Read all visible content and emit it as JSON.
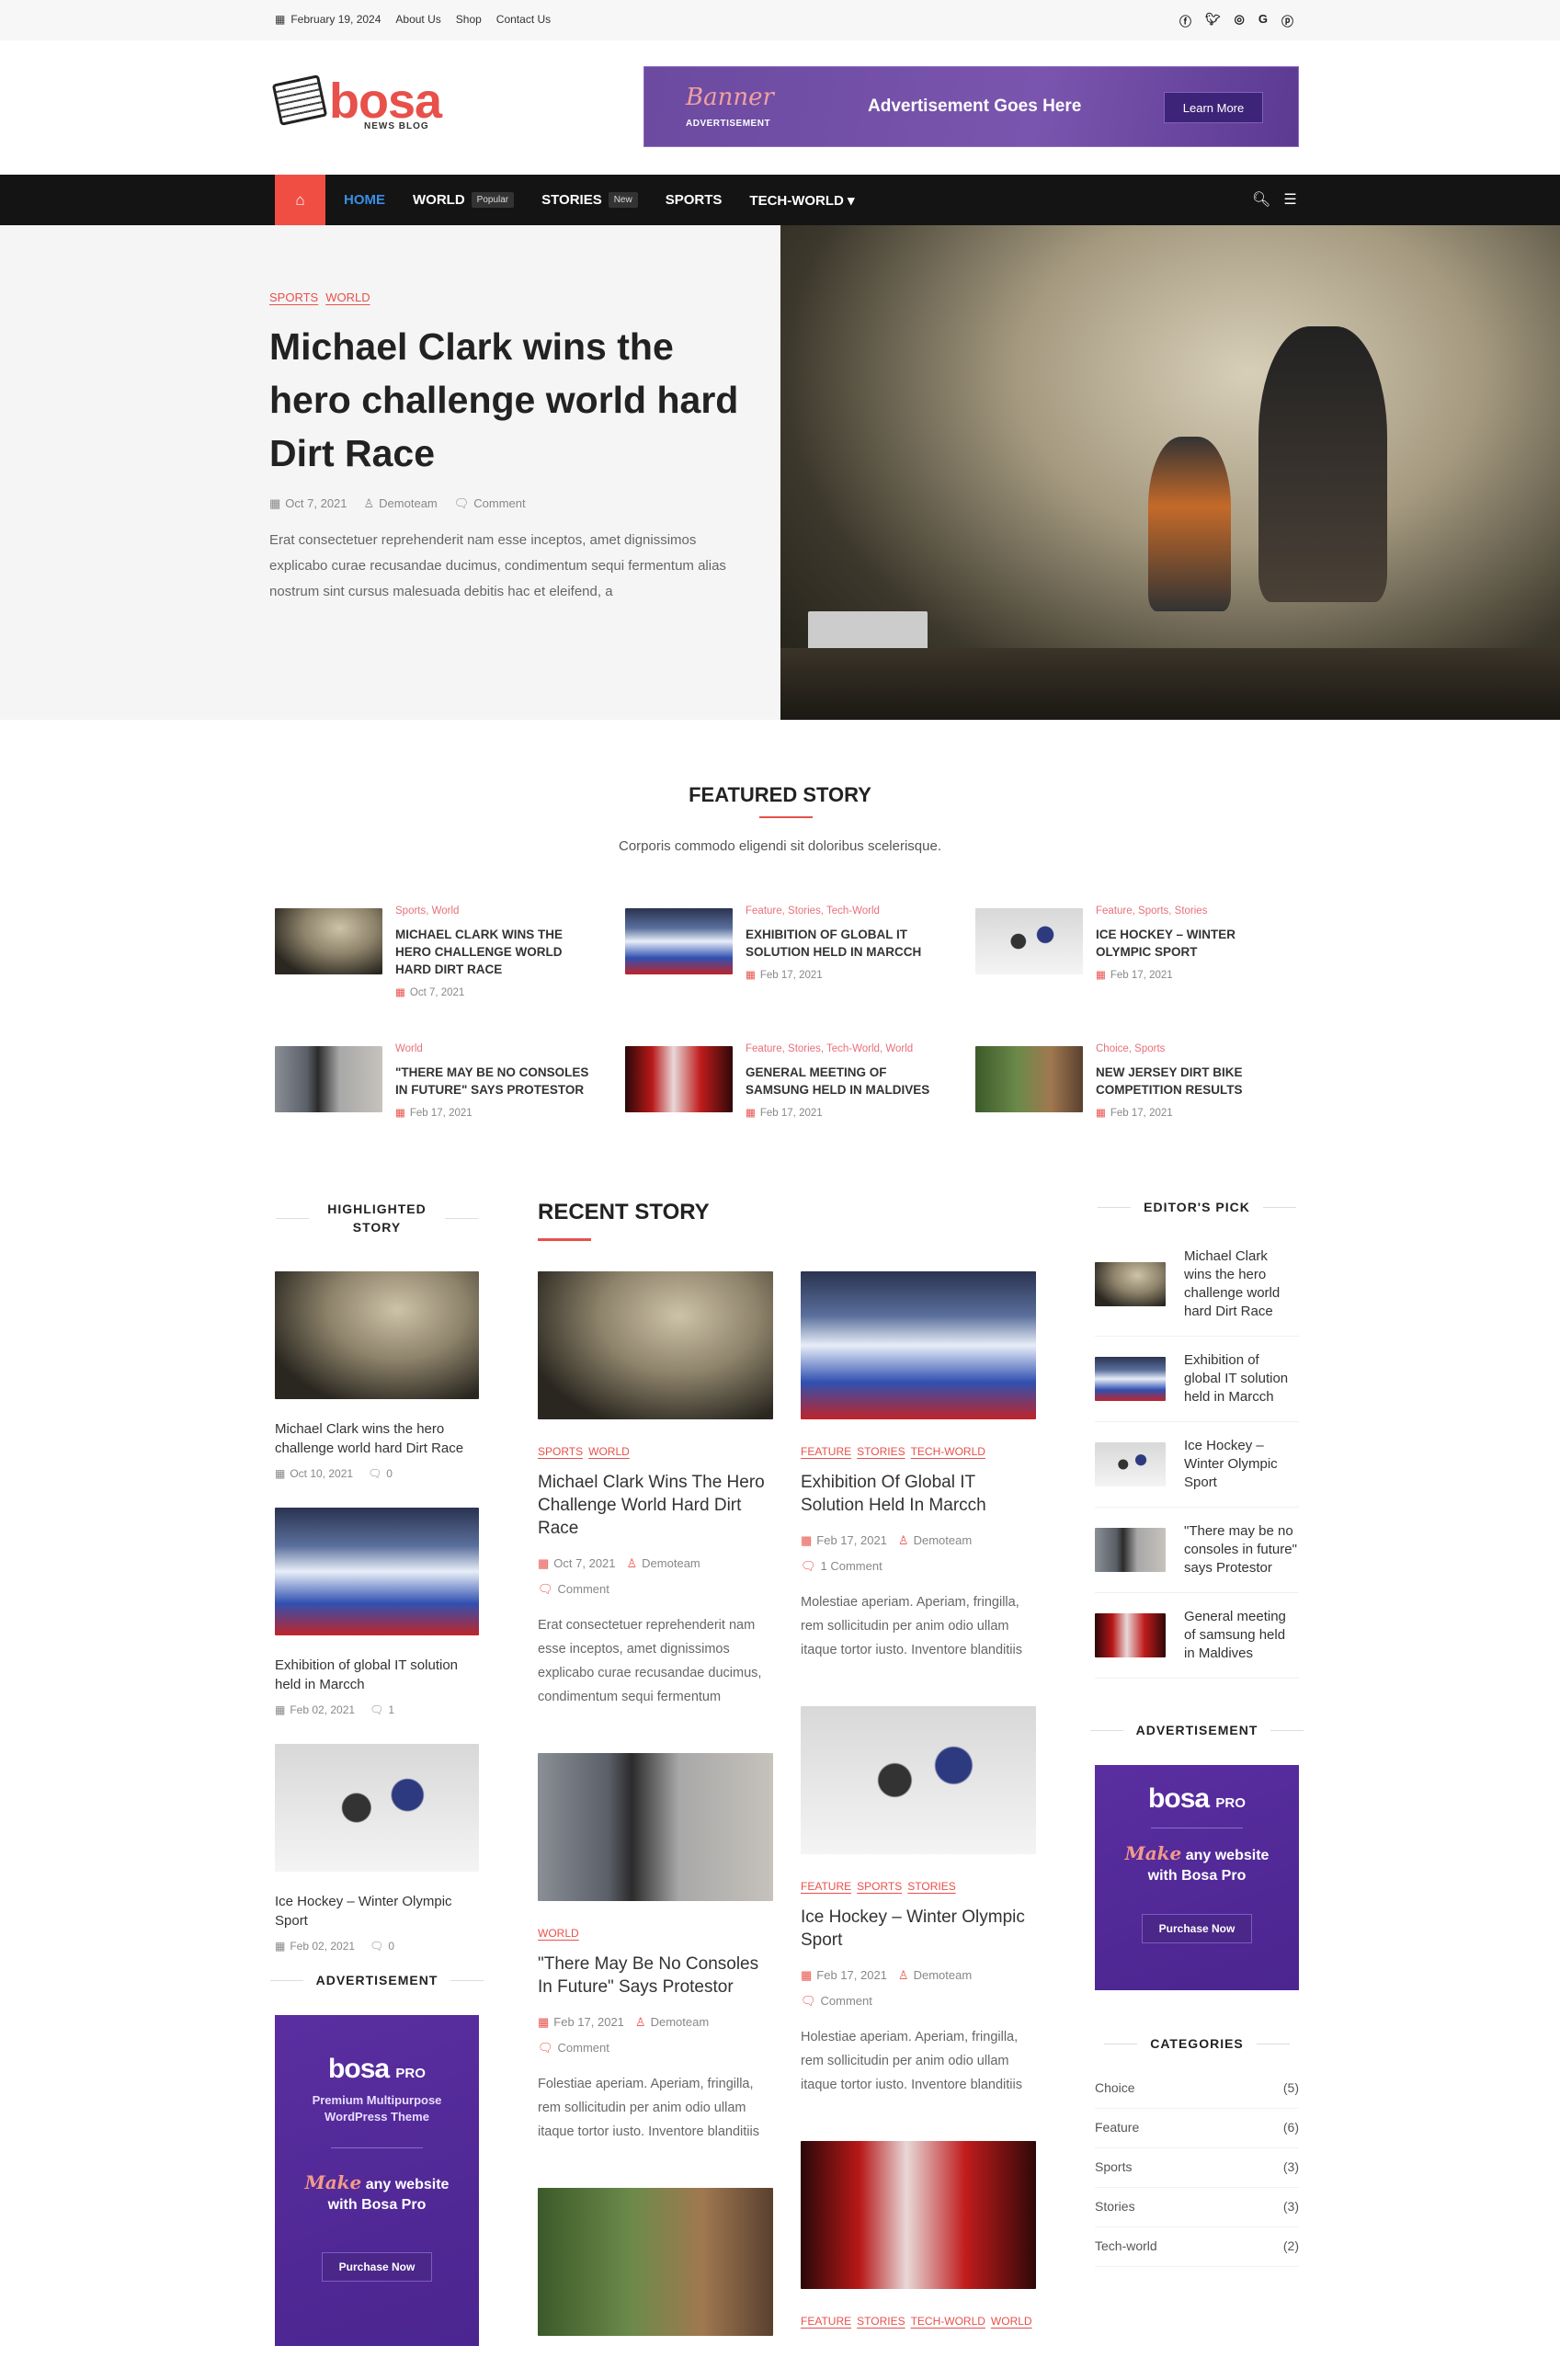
{
  "topbar": {
    "date": "February 19, 2024",
    "links": [
      "About Us",
      "Shop",
      "Contact Us"
    ],
    "social": [
      "facebook-icon",
      "twitter-icon",
      "instagram-icon",
      "google-icon",
      "pinterest-icon"
    ]
  },
  "logo": {
    "word": "bosa",
    "sub": "NEWS BLOG"
  },
  "banner": {
    "script": "Banner",
    "label": "ADVERTISEMENT",
    "text": "Advertisement Goes Here",
    "button": "Learn More"
  },
  "nav": {
    "items": [
      {
        "label": "HOME",
        "active": true
      },
      {
        "label": "WORLD",
        "badge": "Popular"
      },
      {
        "label": "STORIES",
        "badge": "New"
      },
      {
        "label": "SPORTS"
      },
      {
        "label": "TECH-WORLD ▾"
      }
    ]
  },
  "hero": {
    "cats": [
      "SPORTS",
      "WORLD"
    ],
    "title": "Michael Clark wins the hero challenge world hard Dirt Race",
    "date": "Oct 7, 2021",
    "author": "Demoteam",
    "comment": "Comment",
    "excerpt": "Erat consectetuer reprehenderit nam esse inceptos, amet dignissimos explicabo curae recusandae ducimus, condimentum sequi fermentum alias nostrum sint cursus malesuada debitis hac et eleifend, a"
  },
  "featured": {
    "title": "FEATURED STORY",
    "subtitle": "Corporis commodo eligendi sit doloribus scelerisque.",
    "items": [
      {
        "cats": "Sports, World",
        "title": "Michael Clark wins the hero challenge world hard Dirt Race",
        "date": "Oct 7, 2021",
        "img": "dirt"
      },
      {
        "cats": "Feature, Stories, Tech-World",
        "title": "Exhibition of global IT solution held in Marcch",
        "date": "Feb 17, 2021",
        "img": "expo"
      },
      {
        "cats": "Feature, Sports, Stories",
        "title": "Ice Hockey – Winter Olympic Sport",
        "date": "Feb 17, 2021",
        "img": "hockey"
      },
      {
        "cats": "World",
        "title": "\"There may be no consoles in future\" says protestor",
        "date": "Feb 17, 2021",
        "img": "protest"
      },
      {
        "cats": "Feature, Stories, Tech-World, World",
        "title": "General meeting of Samsung held in Maldives",
        "date": "Feb 17, 2021",
        "img": "samsung"
      },
      {
        "cats": "Choice, Sports",
        "title": "New Jersey dirt bike competition results",
        "date": "Feb 17, 2021",
        "img": "bike"
      }
    ]
  },
  "highlighted": {
    "title": "HIGHLIGHTED STORY",
    "items": [
      {
        "title": "Michael Clark wins the hero challenge world hard Dirt Race",
        "date": "Oct 10, 2021",
        "comments": "0",
        "img": "dirt"
      },
      {
        "title": "Exhibition of global IT solution held in Marcch",
        "date": "Feb 02, 2021",
        "comments": "1",
        "img": "expo"
      },
      {
        "title": "Ice Hockey – Winter Olympic Sport",
        "date": "Feb 02, 2021",
        "comments": "0",
        "img": "hockey"
      }
    ]
  },
  "left_ad": {
    "heading": "ADVERTISEMENT",
    "brand": "bosa",
    "pro": "PRO",
    "tagline": "Premium Multipurpose WordPress Theme",
    "make": "Make",
    "rest": "any website with Bosa Pro",
    "button": "Purchase Now"
  },
  "recent": {
    "title": "RECENT STORY",
    "columns": [
      [
        {
          "cats": [
            "SPORTS",
            "WORLD"
          ],
          "title": "Michael Clark Wins The Hero Challenge World Hard Dirt Race",
          "date": "Oct 7, 2021",
          "author": "Demoteam",
          "comment": "Comment",
          "excerpt": "Erat consectetuer reprehenderit nam esse inceptos, amet dignissimos explicabo curae recusandae ducimus, condimentum sequi fermentum",
          "img": "dirt"
        },
        {
          "cats": [
            "WORLD"
          ],
          "title": "\"There May Be No Consoles In Future\" Says Protestor",
          "date": "Feb 17, 2021",
          "author": "Demoteam",
          "comment": "Comment",
          "excerpt": "Folestiae aperiam. Aperiam, fringilla, rem sollicitudin per anim odio ullam itaque tortor iusto. Inventore blanditiis",
          "img": "protest"
        },
        {
          "img": "bike"
        }
      ],
      [
        {
          "cats": [
            "FEATURE",
            "STORIES",
            "TECH-WORLD"
          ],
          "title": "Exhibition Of Global IT Solution Held In Marcch",
          "date": "Feb 17, 2021",
          "author": "Demoteam",
          "comment": "1 Comment",
          "excerpt": "Molestiae aperiam. Aperiam, fringilla, rem sollicitudin per anim odio ullam itaque tortor iusto. Inventore blanditiis",
          "img": "expo"
        },
        {
          "cats": [
            "FEATURE",
            "SPORTS",
            "STORIES"
          ],
          "title": "Ice Hockey – Winter Olympic Sport",
          "date": "Feb 17, 2021",
          "author": "Demoteam",
          "comment": "Comment",
          "excerpt": "Holestiae aperiam. Aperiam, fringilla, rem sollicitudin per anim odio ullam itaque tortor iusto. Inventore blanditiis",
          "img": "hockey"
        },
        {
          "cats": [
            "FEATURE",
            "STORIES",
            "TECH-WORLD",
            "WORLD"
          ],
          "img": "samsung"
        }
      ]
    ]
  },
  "editors_pick": {
    "title": "EDITOR'S PICK",
    "items": [
      {
        "title": "Michael Clark wins the hero challenge world hard Dirt Race",
        "img": "dirt"
      },
      {
        "title": "Exhibition of global IT solution held in Marcch",
        "img": "expo"
      },
      {
        "title": "Ice Hockey – Winter Olympic Sport",
        "img": "hockey"
      },
      {
        "title": "\"There may be no consoles in future\" says Protestor",
        "img": "protest"
      },
      {
        "title": "General meeting of samsung held in Maldives",
        "img": "samsung"
      }
    ]
  },
  "right_ad": {
    "heading": "ADVERTISEMENT",
    "brand": "bosa",
    "pro": "PRO",
    "make": "Make",
    "rest": "any website with Bosa Pro",
    "button": "Purchase Now"
  },
  "categories": {
    "title": "CATEGORIES",
    "items": [
      {
        "name": "Choice",
        "count": "(5)"
      },
      {
        "name": "Feature",
        "count": "(6)"
      },
      {
        "name": "Sports",
        "count": "(3)"
      },
      {
        "name": "Stories",
        "count": "(3)"
      },
      {
        "name": "Tech-world",
        "count": "(2)"
      }
    ]
  },
  "colors": {
    "accent": "#e8504a",
    "nav_bg": "#141414",
    "home_bg": "#f04e43",
    "nav_active": "#3a8ee6",
    "ad_purple": "#5a2ea0"
  }
}
